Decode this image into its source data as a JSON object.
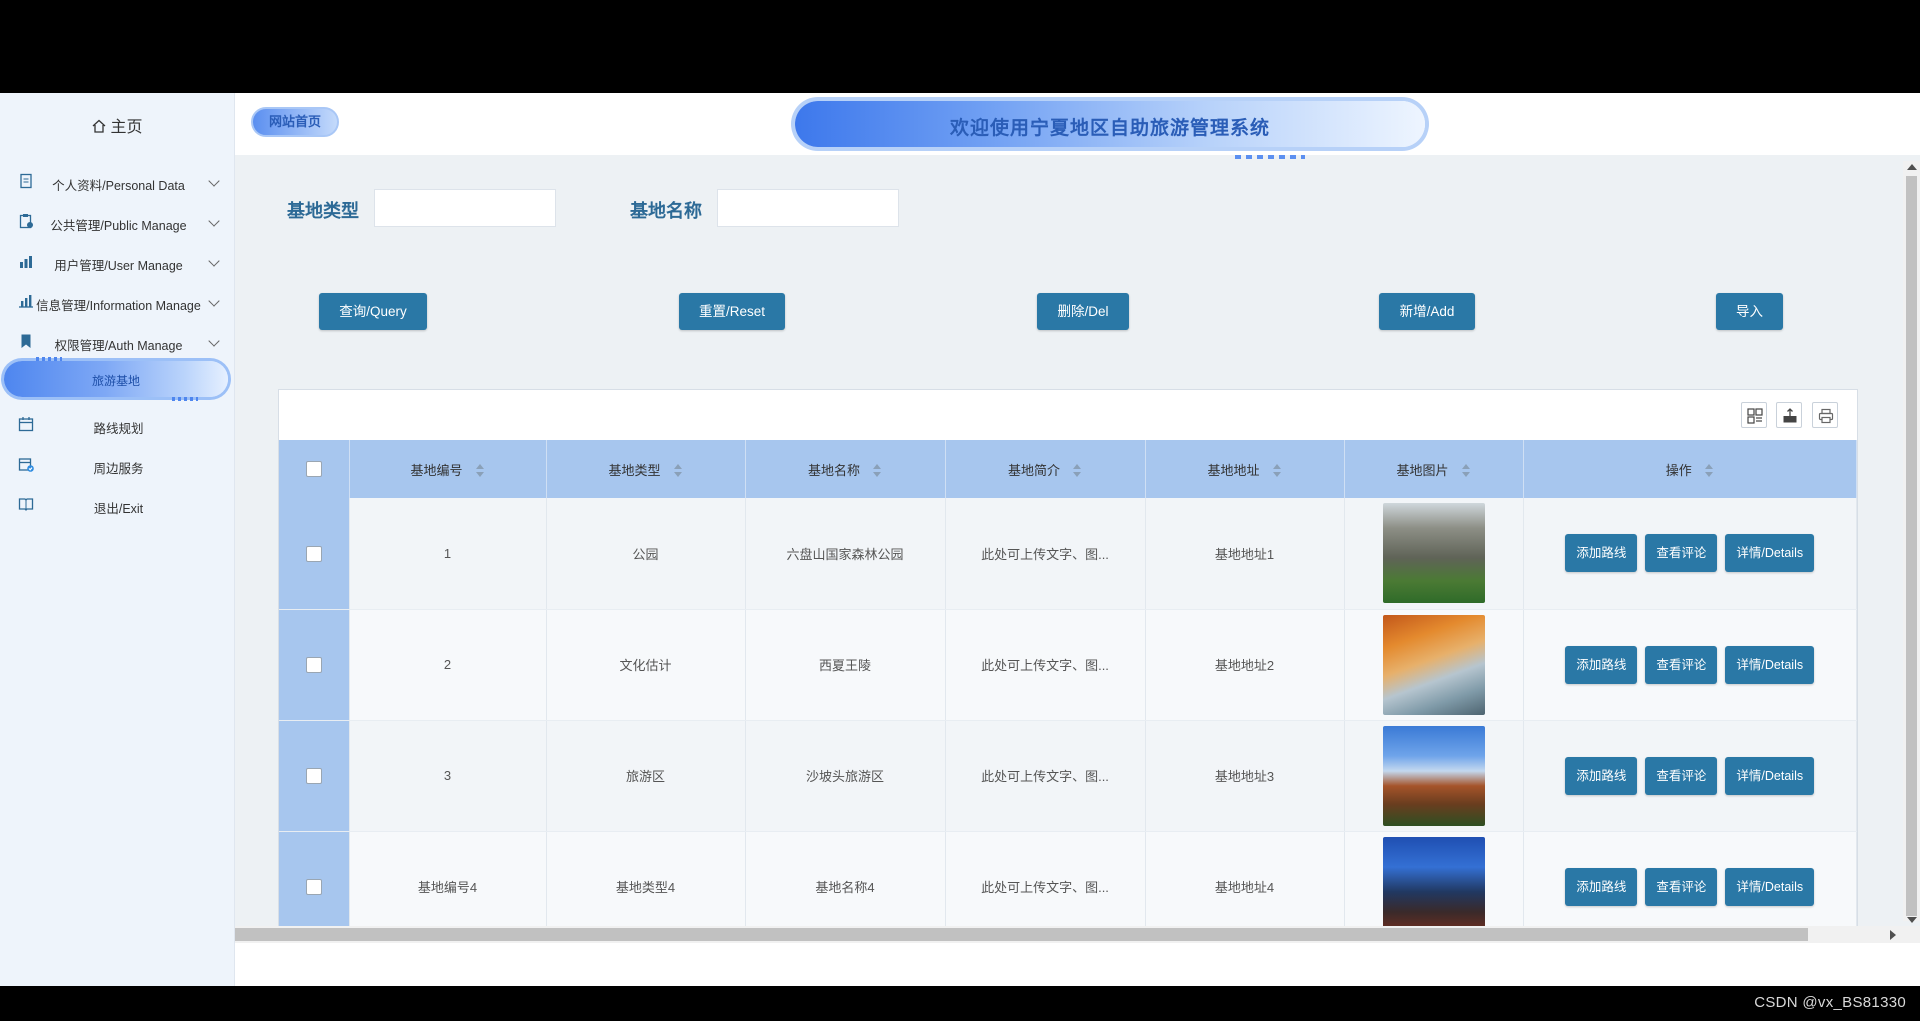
{
  "sidebar": {
    "home_label": "主页",
    "items": [
      {
        "label": "个人资料/Personal Data",
        "icon": "profile-doc-icon",
        "has_chevron": true
      },
      {
        "label": "公共管理/Public Manage",
        "icon": "clipboard-icon",
        "has_chevron": true
      },
      {
        "label": "用户管理/User Manage",
        "icon": "users-chart-icon",
        "has_chevron": true
      },
      {
        "label": "信息管理/Information Manage",
        "icon": "bar-chart-icon",
        "has_chevron": true
      },
      {
        "label": "权限管理/Auth Manage",
        "icon": "bookmark-icon",
        "has_chevron": true
      },
      {
        "label": "旅游基地",
        "icon": "",
        "active": true
      },
      {
        "label": "路线规划",
        "icon": "calendar-icon"
      },
      {
        "label": "周边服务",
        "icon": "calendar-check-icon"
      },
      {
        "label": "退出/Exit",
        "icon": "book-icon"
      }
    ]
  },
  "header": {
    "site_home": "网站首页",
    "title": "欢迎使用宁夏地区自助旅游管理系统"
  },
  "search": {
    "type_label": "基地类型",
    "type_value": "",
    "name_label": "基地名称",
    "name_value": ""
  },
  "buttons": {
    "query": "查询/Query",
    "reset": "重置/Reset",
    "delete": "删除/Del",
    "add": "新增/Add",
    "import": "导入"
  },
  "table": {
    "headers": [
      "基地编号",
      "基地类型",
      "基地名称",
      "基地简介",
      "基地地址",
      "基地图片",
      "操作"
    ],
    "rows": [
      {
        "id": "1",
        "type": "公园",
        "name": "六盘山国家森林公园",
        "intro": "此处可上传文字、图...",
        "address": "基地地址1"
      },
      {
        "id": "2",
        "type": "文化估计",
        "name": "西夏王陵",
        "intro": "此处可上传文字、图...",
        "address": "基地地址2"
      },
      {
        "id": "3",
        "type": "旅游区",
        "name": "沙坡头旅游区",
        "intro": "此处可上传文字、图...",
        "address": "基地地址3"
      },
      {
        "id": "基地编号4",
        "type": "基地类型4",
        "name": "基地名称4",
        "intro": "此处可上传文字、图...",
        "address": "基地地址4"
      }
    ],
    "actions": [
      "添加路线",
      "查看评论",
      "详情/Details"
    ]
  },
  "footer": {
    "watermark": "CSDN @vx_BS81330"
  },
  "colors": {
    "primary_button": "#2a78a6",
    "table_header": "#a7c6ee",
    "accent_blue": "#4e86ef"
  }
}
